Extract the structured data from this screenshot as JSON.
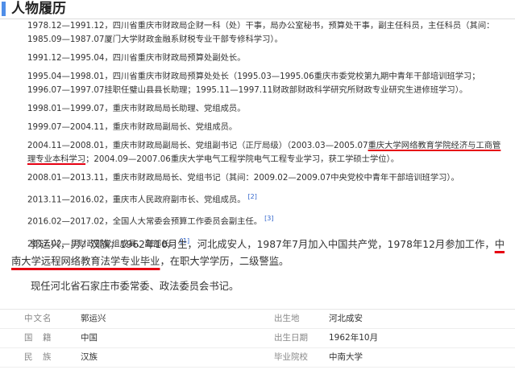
{
  "section_title": "人物履历",
  "entries": [
    {
      "text": "1978.12—1991.12，四川省重庆市财政局企财一科（处）干事，局办公室秘书，预算处干事，副主任科员，主任科员（其间：1985.09—1987.07厦门大学财政金融系财税专业干部专修科学习）。"
    },
    {
      "text": "1991.12—1995.04，四川省重庆市财政局预算处副处长。"
    },
    {
      "text": "1995.04—1998.01，四川省重庆市财政局预算处处长（1995.03—1995.06重庆市委党校第九期中青年干部培训班学习；1996.07—1997.07挂职任璧山县县长助理；1995.11—1997.11财政部财政科学研究所财政专业研究生进修班学习）。"
    },
    {
      "text": "1998.01—1999.07，重庆市财政局局长助理、党组成员。"
    },
    {
      "text": "1999.07—2004.11，重庆市财政局副局长、党组成员。"
    },
    {
      "text_a": "2004.11—2008.01，重庆市财政局副局长、党组副书记（正厅局级）（2003.03—2005.07",
      "text_b": "重庆大学网络教育学院经济与工商管理专业本科学习",
      "text_c": "；2004.09—2007.06重庆大学电气工程学院电气工程专业学习，获工学硕士学位）。"
    },
    {
      "text": "2008.01—2013.11，重庆市财政局局长、党组书记（其间：2009.02—2009.07中央党校中青年干部培训班学习）。"
    },
    {
      "text": "2013.11—2016.02，重庆市人民政府副市长、党组成员。",
      "ref": "[2]"
    },
    {
      "text": "2016.02—2017.02，全国人大常委会预算工作委员会副主任。",
      "ref": "[3]"
    },
    {
      "text": "2017.02—，财政部党组成员、副部长。",
      "ref": "[1]"
    }
  ],
  "para1": {
    "text_a": "郭运兴，男，汉族，1962年10月生，河北成安人，1987年7月加入中国共产党，1978年12月参加工作，",
    "text_b": "中南大学远程网络教育法学专业毕业",
    "text_c": "，在职大学学历，二级警监。"
  },
  "para2": "现任河北省石家庄市委常委、政法委员会书记。",
  "info": [
    {
      "k1": "中文名",
      "v1": "郭运兴",
      "k2": "出生地",
      "v2": "河北成安"
    },
    {
      "k1": "国　籍",
      "v1": "中国",
      "k2": "出生日期",
      "v2": "1962年10月"
    },
    {
      "k1": "民　族",
      "v1": "汉族",
      "k2": "毕业院校",
      "v2": "中南大学"
    }
  ],
  "colors": {
    "accent": "#4f8ee8",
    "highlight": "#e60012",
    "link": "#3366cc"
  }
}
